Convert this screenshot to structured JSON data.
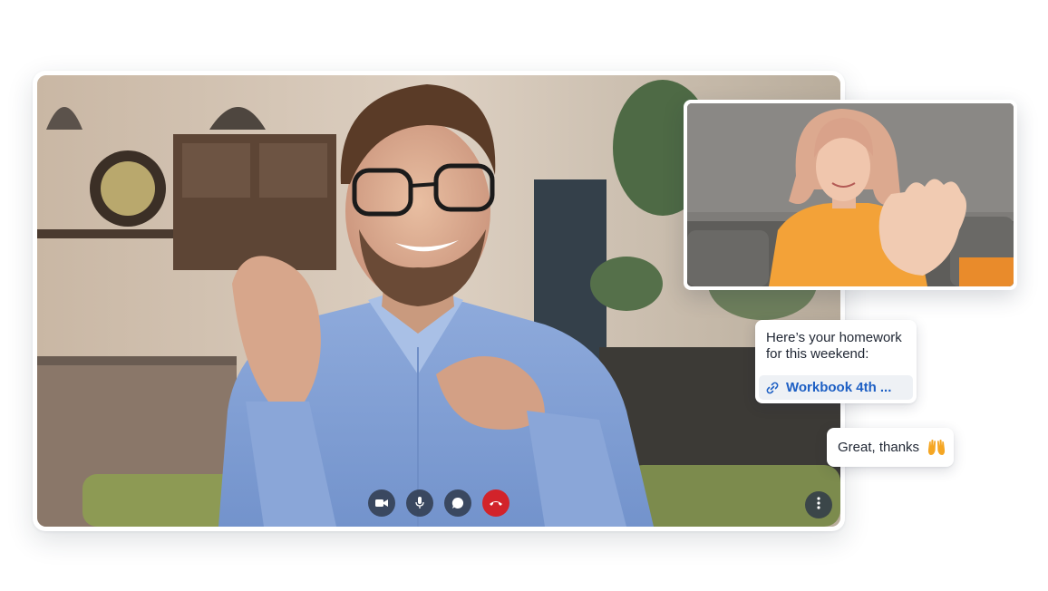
{
  "call": {
    "controls": [
      {
        "name": "camera",
        "icon": "video-camera-icon"
      },
      {
        "name": "microphone",
        "icon": "microphone-icon"
      },
      {
        "name": "chat",
        "icon": "chat-bubble-icon"
      },
      {
        "name": "end-call",
        "icon": "phone-hangup-icon"
      }
    ],
    "more_icon": "more-vertical-icon",
    "end_call_color": "#d2232a"
  },
  "chat": {
    "messages": [
      {
        "text": "Here’s your homework for this weekend:",
        "link": {
          "icon": "link-icon",
          "label": "Workbook 4th ...",
          "color": "#1d5fc4"
        }
      },
      {
        "text": "Great, thanks",
        "emoji": "raised-hands-icon"
      }
    ]
  }
}
